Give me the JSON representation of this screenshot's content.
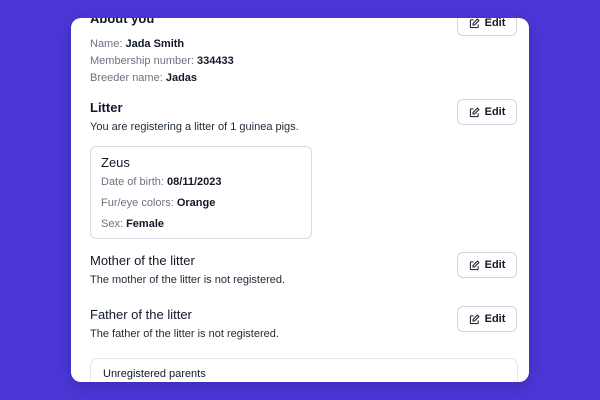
{
  "about": {
    "title": "About you",
    "name_label": "Name:",
    "name_value": "Jada Smith",
    "membership_label": "Membership number:",
    "membership_value": "334433",
    "breeder_label": "Breeder name:",
    "breeder_value": "Jadas",
    "edit_label": "Edit"
  },
  "litter": {
    "title": "Litter",
    "description": "You are registering a litter of 1 guinea pigs.",
    "edit_label": "Edit",
    "pig": {
      "name": "Zeus",
      "dob_label": "Date of birth:",
      "dob_value": "08/11/2023",
      "colors_label": "Fur/eye colors:",
      "colors_value": "Orange",
      "sex_label": "Sex:",
      "sex_value": "Female"
    }
  },
  "mother": {
    "title": "Mother of the litter",
    "description": "The mother of the litter is not registered.",
    "edit_label": "Edit"
  },
  "father": {
    "title": "Father of the litter",
    "description": "The father of the litter is not registered.",
    "edit_label": "Edit"
  },
  "unregistered": {
    "title": "Unregistered parents"
  },
  "colors": {
    "background": "#4a37d6",
    "card": "#ffffff"
  }
}
